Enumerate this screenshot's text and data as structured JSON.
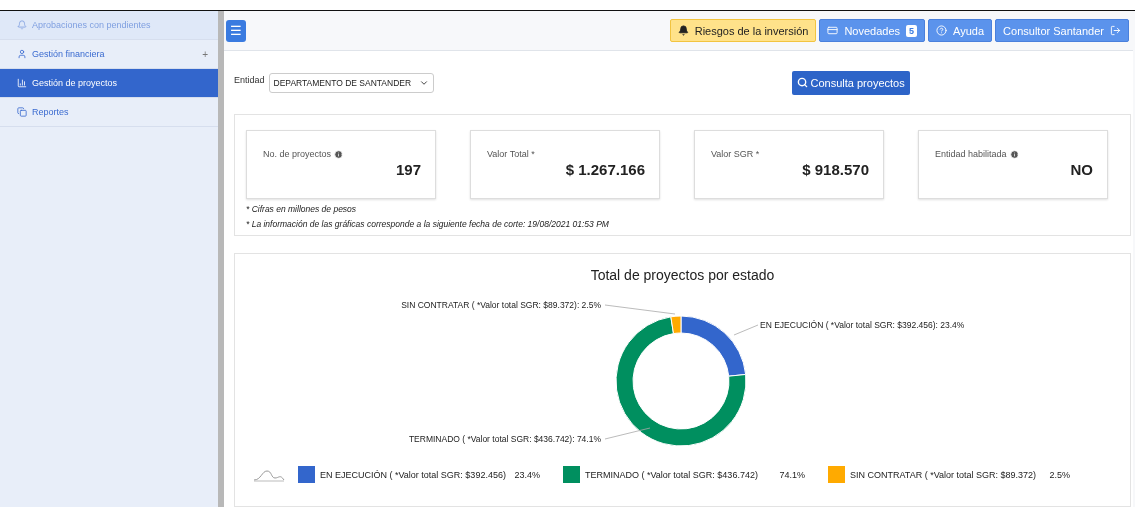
{
  "sidebar": {
    "items": [
      {
        "label": "Aprobaciones con pendientes",
        "selected": false,
        "faded": true
      },
      {
        "label": "Gestión financiera",
        "selected": false,
        "faded": false,
        "expander": "+"
      },
      {
        "label": "Gestión de proyectos",
        "selected": true,
        "faded": false
      },
      {
        "label": "Reportes",
        "selected": false,
        "faded": false
      }
    ]
  },
  "topbar": {
    "menu_button": "☰",
    "buttons": [
      {
        "kind": "warning",
        "label": "Riesgos de la inversión"
      },
      {
        "kind": "news",
        "label": "Novedades",
        "badge": "5"
      },
      {
        "kind": "help",
        "label": "Ayuda"
      },
      {
        "kind": "user",
        "label": "Consultor Santander"
      }
    ]
  },
  "filter": {
    "label": "Entidad",
    "value": "DEPARTAMENTO DE SANTANDER",
    "button": "Consulta proyectos"
  },
  "stats": [
    {
      "label": "No. de proyectos",
      "info": true,
      "value": "197"
    },
    {
      "label": "Valor Total *",
      "info": false,
      "value": "$ 1.267.166"
    },
    {
      "label": "Valor SGR *",
      "info": false,
      "value": "$ 918.570"
    },
    {
      "label": "Entidad habilitada",
      "info": true,
      "value": "NO"
    }
  ],
  "notes": [
    "* Cifras en millones de pesos",
    "* La información de las gráficas corresponde a la siguiente fecha de corte: 19/08/2021 01:53 PM"
  ],
  "chart": {
    "chart_data": {
      "type": "donut",
      "title": "Total de proyectos por estado",
      "values": [
        23.4,
        74.1,
        2.5
      ],
      "value_labels": [
        "EN EJECUCIÓN ( *Valor total SGR: $392.456): 23.4%",
        "TERMINADO ( *Valor total SGR: $436.742): 74.1%",
        "SIN CONTRATAR ( *Valor total SGR: $89.372): 2.5%"
      ]
    },
    "legend": [
      {
        "label": "EN EJECUCIÓN ( *Valor total SGR: $392.456)",
        "percent": "23.4%",
        "color": "#3366cc"
      },
      {
        "label": "TERMINADO ( *Valor total SGR: $436.742)",
        "percent": "74.1%",
        "color": "#008f5f"
      },
      {
        "label": "SIN CONTRATAR ( *Valor total SGR: $89.372)",
        "percent": "2.5%",
        "color": "#ffaa00"
      }
    ]
  }
}
